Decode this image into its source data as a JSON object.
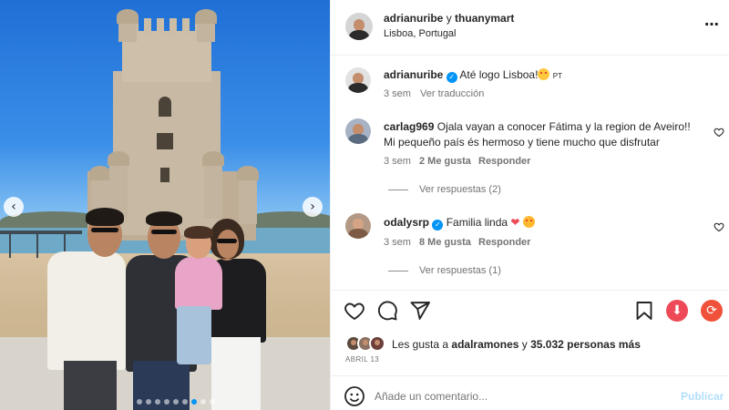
{
  "post_header": {
    "user1": "adrianuribe",
    "connector": "y",
    "user2": "thuanymart",
    "location": "Lisboa, Portugal",
    "more_icon": "ellipsis-icon"
  },
  "caption": {
    "username": "adrianuribe",
    "text": "Até logo Lisboa!",
    "badge": "PT",
    "time": "3 sem",
    "translate": "Ver traducción"
  },
  "comments": [
    {
      "username": "carlag969",
      "text_line1": "Ojala vayan a conocer Fátima y la region de Aveiro!!",
      "text_line2": "Mi pequeño país és hermoso y tiene mucho que disfrutar",
      "time": "3 sem",
      "likes": "2 Me gusta",
      "reply": "Responder",
      "replies": "Ver respuestas (2)"
    },
    {
      "username": "odalysrp",
      "text": "Familia linda",
      "time": "3 sem",
      "likes": "8 Me gusta",
      "reply": "Responder",
      "replies": "Ver respuestas (1)"
    }
  ],
  "likes": {
    "prefix": "Les gusta a",
    "user": "adalramones",
    "connector": "y",
    "count": "35.032 personas más"
  },
  "date": "ABRIL 13",
  "comment_input": {
    "placeholder": "Añade un comentario...",
    "submit": "Publicar"
  },
  "colors": {
    "accent": "#0095f6",
    "download": "#ed4956",
    "repost": "#f0513b"
  },
  "carousel": {
    "active_index": 6,
    "count": 9
  }
}
